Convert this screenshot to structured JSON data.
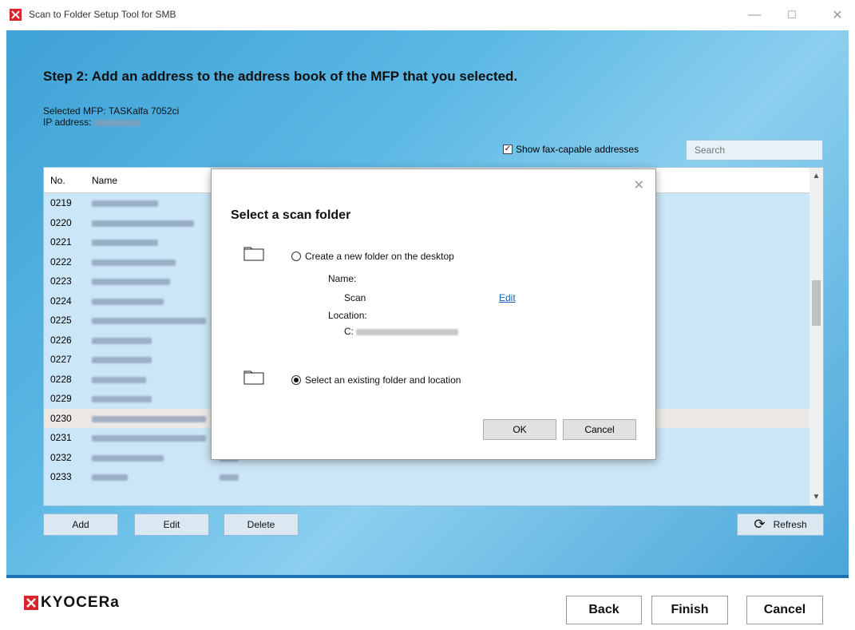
{
  "window": {
    "title": "Scan to Folder Setup Tool for SMB",
    "minimize": "—",
    "maximize": "☐",
    "close": "✕"
  },
  "main": {
    "step_title": "Step 2: Add an address to the address book of the MFP that you selected.",
    "selected_mfp_label": "Selected MFP: TASKalfa 7052ci",
    "ip_label": "IP address:",
    "fax_checkbox_label": "Show fax-capable addresses",
    "fax_checkbox_checked": true,
    "search_placeholder": "Search"
  },
  "table": {
    "headers": {
      "no": "No.",
      "name": "Name"
    },
    "rows": [
      {
        "no": "0219",
        "w": 0.55
      },
      {
        "no": "0220",
        "w": 0.85
      },
      {
        "no": "0221",
        "w": 0.55
      },
      {
        "no": "0222",
        "w": 0.7
      },
      {
        "no": "0223",
        "w": 0.65
      },
      {
        "no": "0224",
        "w": 0.6
      },
      {
        "no": "0225",
        "w": 0.95
      },
      {
        "no": "0226",
        "w": 0.5
      },
      {
        "no": "0227",
        "w": 0.5
      },
      {
        "no": "0228",
        "w": 0.45
      },
      {
        "no": "0229",
        "w": 0.5
      },
      {
        "no": "0230",
        "w": 0.95,
        "selected": true
      },
      {
        "no": "0231",
        "w": 0.95
      },
      {
        "no": "0232",
        "w": 0.6,
        "extra": true
      },
      {
        "no": "0233",
        "w": 0.3,
        "extra": true
      }
    ]
  },
  "actions": {
    "add": "Add",
    "edit": "Edit",
    "delete": "Delete",
    "refresh": "Refresh"
  },
  "dialog": {
    "title": "Select a scan folder",
    "option_new": "Create a new folder on the desktop",
    "name_label": "Name:",
    "name_value": "Scan",
    "edit_link": "Edit",
    "location_label": "Location:",
    "location_value": "C:",
    "option_existing": "Select an existing folder and location",
    "selected_option": "existing",
    "ok": "OK",
    "cancel": "Cancel"
  },
  "footer": {
    "logo_text": "KYOCERa",
    "back": "Back",
    "finish": "Finish",
    "cancel": "Cancel"
  },
  "colors": {
    "accent": "#1c6fb0",
    "logo_red": "#d9262c"
  }
}
